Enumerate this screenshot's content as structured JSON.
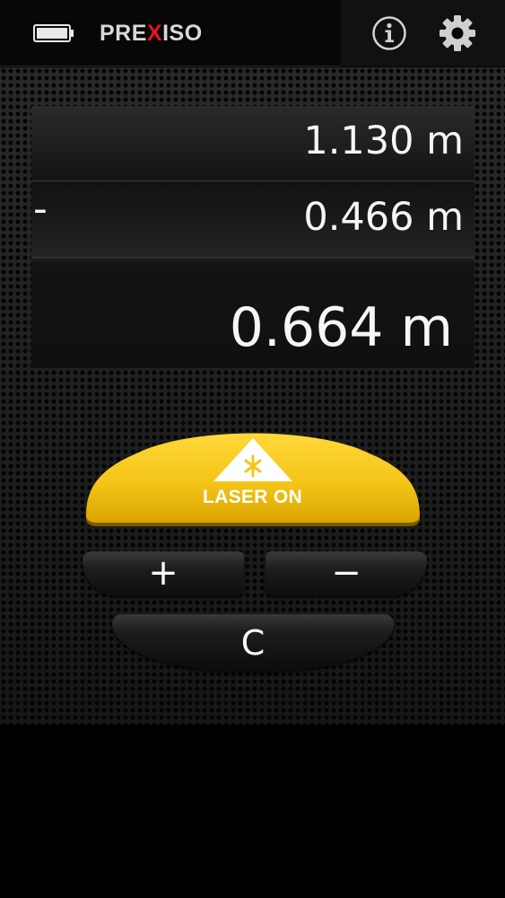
{
  "header": {
    "brand_prefix": "PRE",
    "brand_x": "X",
    "brand_suffix": "ISO",
    "icons": {
      "battery": "battery-icon",
      "info": "info-icon",
      "settings": "gear-icon"
    }
  },
  "display": {
    "row1_value": "1.130 m",
    "row2_operator": "-",
    "row2_value": "0.466 m",
    "result_value": "0.664 m"
  },
  "controls": {
    "laser_label": "LASER ON",
    "laser_icon": "laser-warning-icon",
    "plus_label": "+",
    "minus_label": "−",
    "clear_label": "C"
  },
  "colors": {
    "laser_yellow": "#f5c518",
    "brand_red": "#e3161c",
    "background": "#000000"
  }
}
